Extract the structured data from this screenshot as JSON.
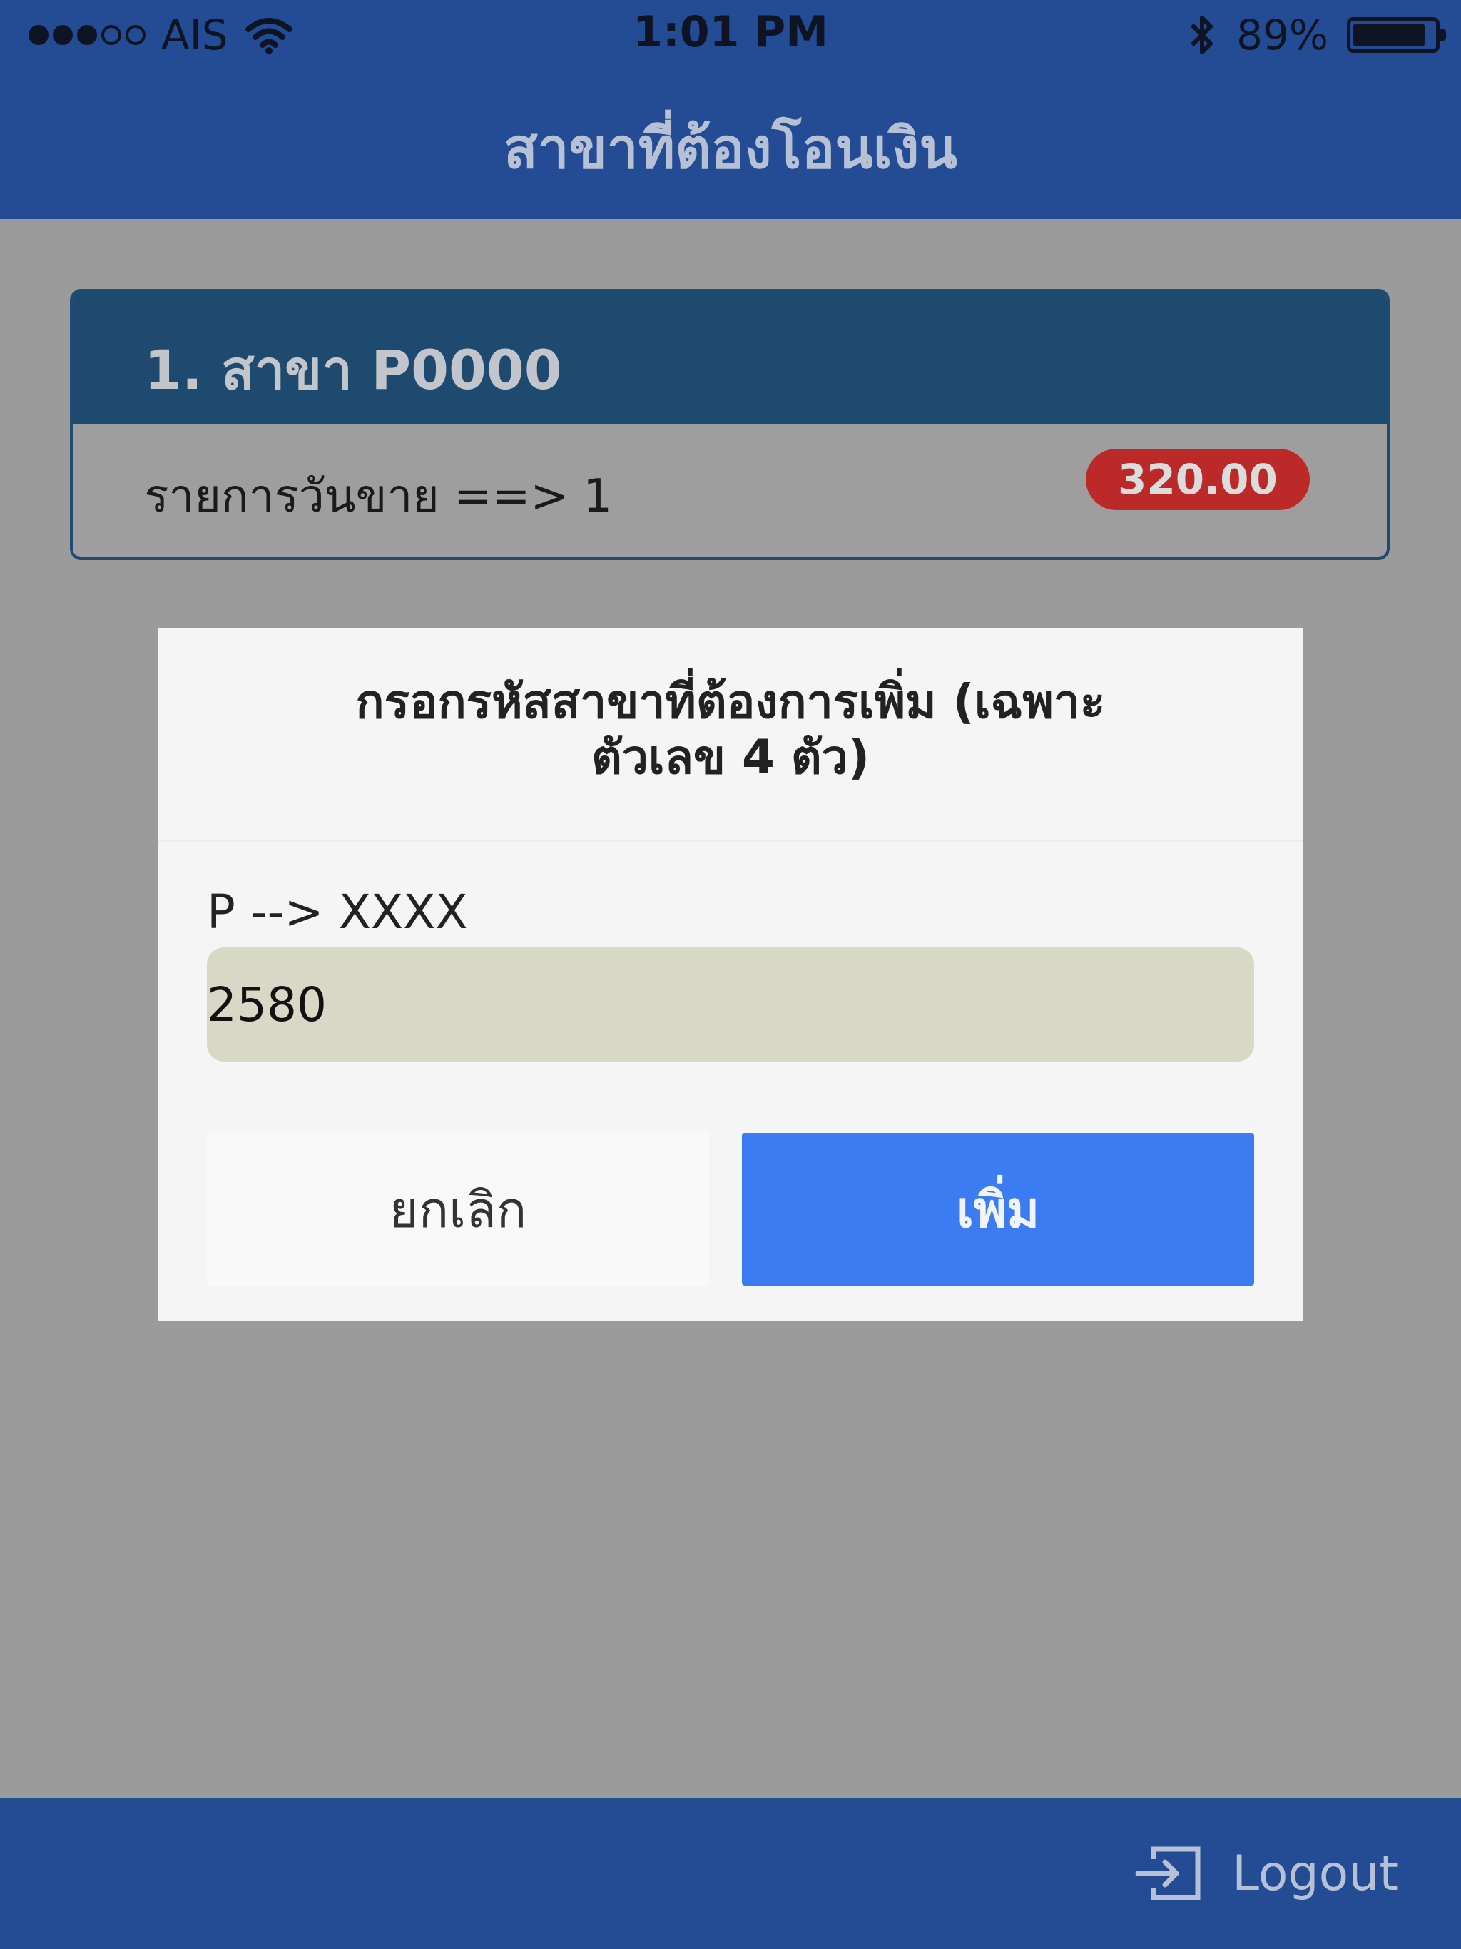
{
  "status_bar": {
    "carrier": "AIS",
    "time": "1:01 PM",
    "battery_percent": "89%",
    "battery_level": 0.89,
    "signal_bars_filled": 3,
    "signal_bars_total": 5,
    "icons": [
      "signal-dots-icon",
      "wifi-icon",
      "bluetooth-icon",
      "battery-icon"
    ]
  },
  "navbar": {
    "title": "สาขาที่ต้องโอนเงิน"
  },
  "branch_card": {
    "header": "1. สาขา P0000",
    "row_label": "รายการวันขาย ==> 1",
    "amount": "320.00"
  },
  "dialog": {
    "title_line1": "กรอกรหัสสาขาที่ต้องการเพิ่ม (เฉพาะ",
    "title_line2": "ตัวเลข 4 ตัว)",
    "input_label": "P --> XXXX",
    "input_value": "2580",
    "cancel_label": "ยกเลิก",
    "add_label": "เพิ่ม"
  },
  "footer": {
    "logout_label": "Logout",
    "logout_icon": "logout-icon"
  },
  "colors": {
    "bar_blue": "#234c94",
    "card_header": "#1f4a6f",
    "badge_red": "#bb2a28",
    "add_button": "#3c7cf2",
    "input_bg": "#d7d8c5",
    "overlay": "#9b9b9b"
  }
}
